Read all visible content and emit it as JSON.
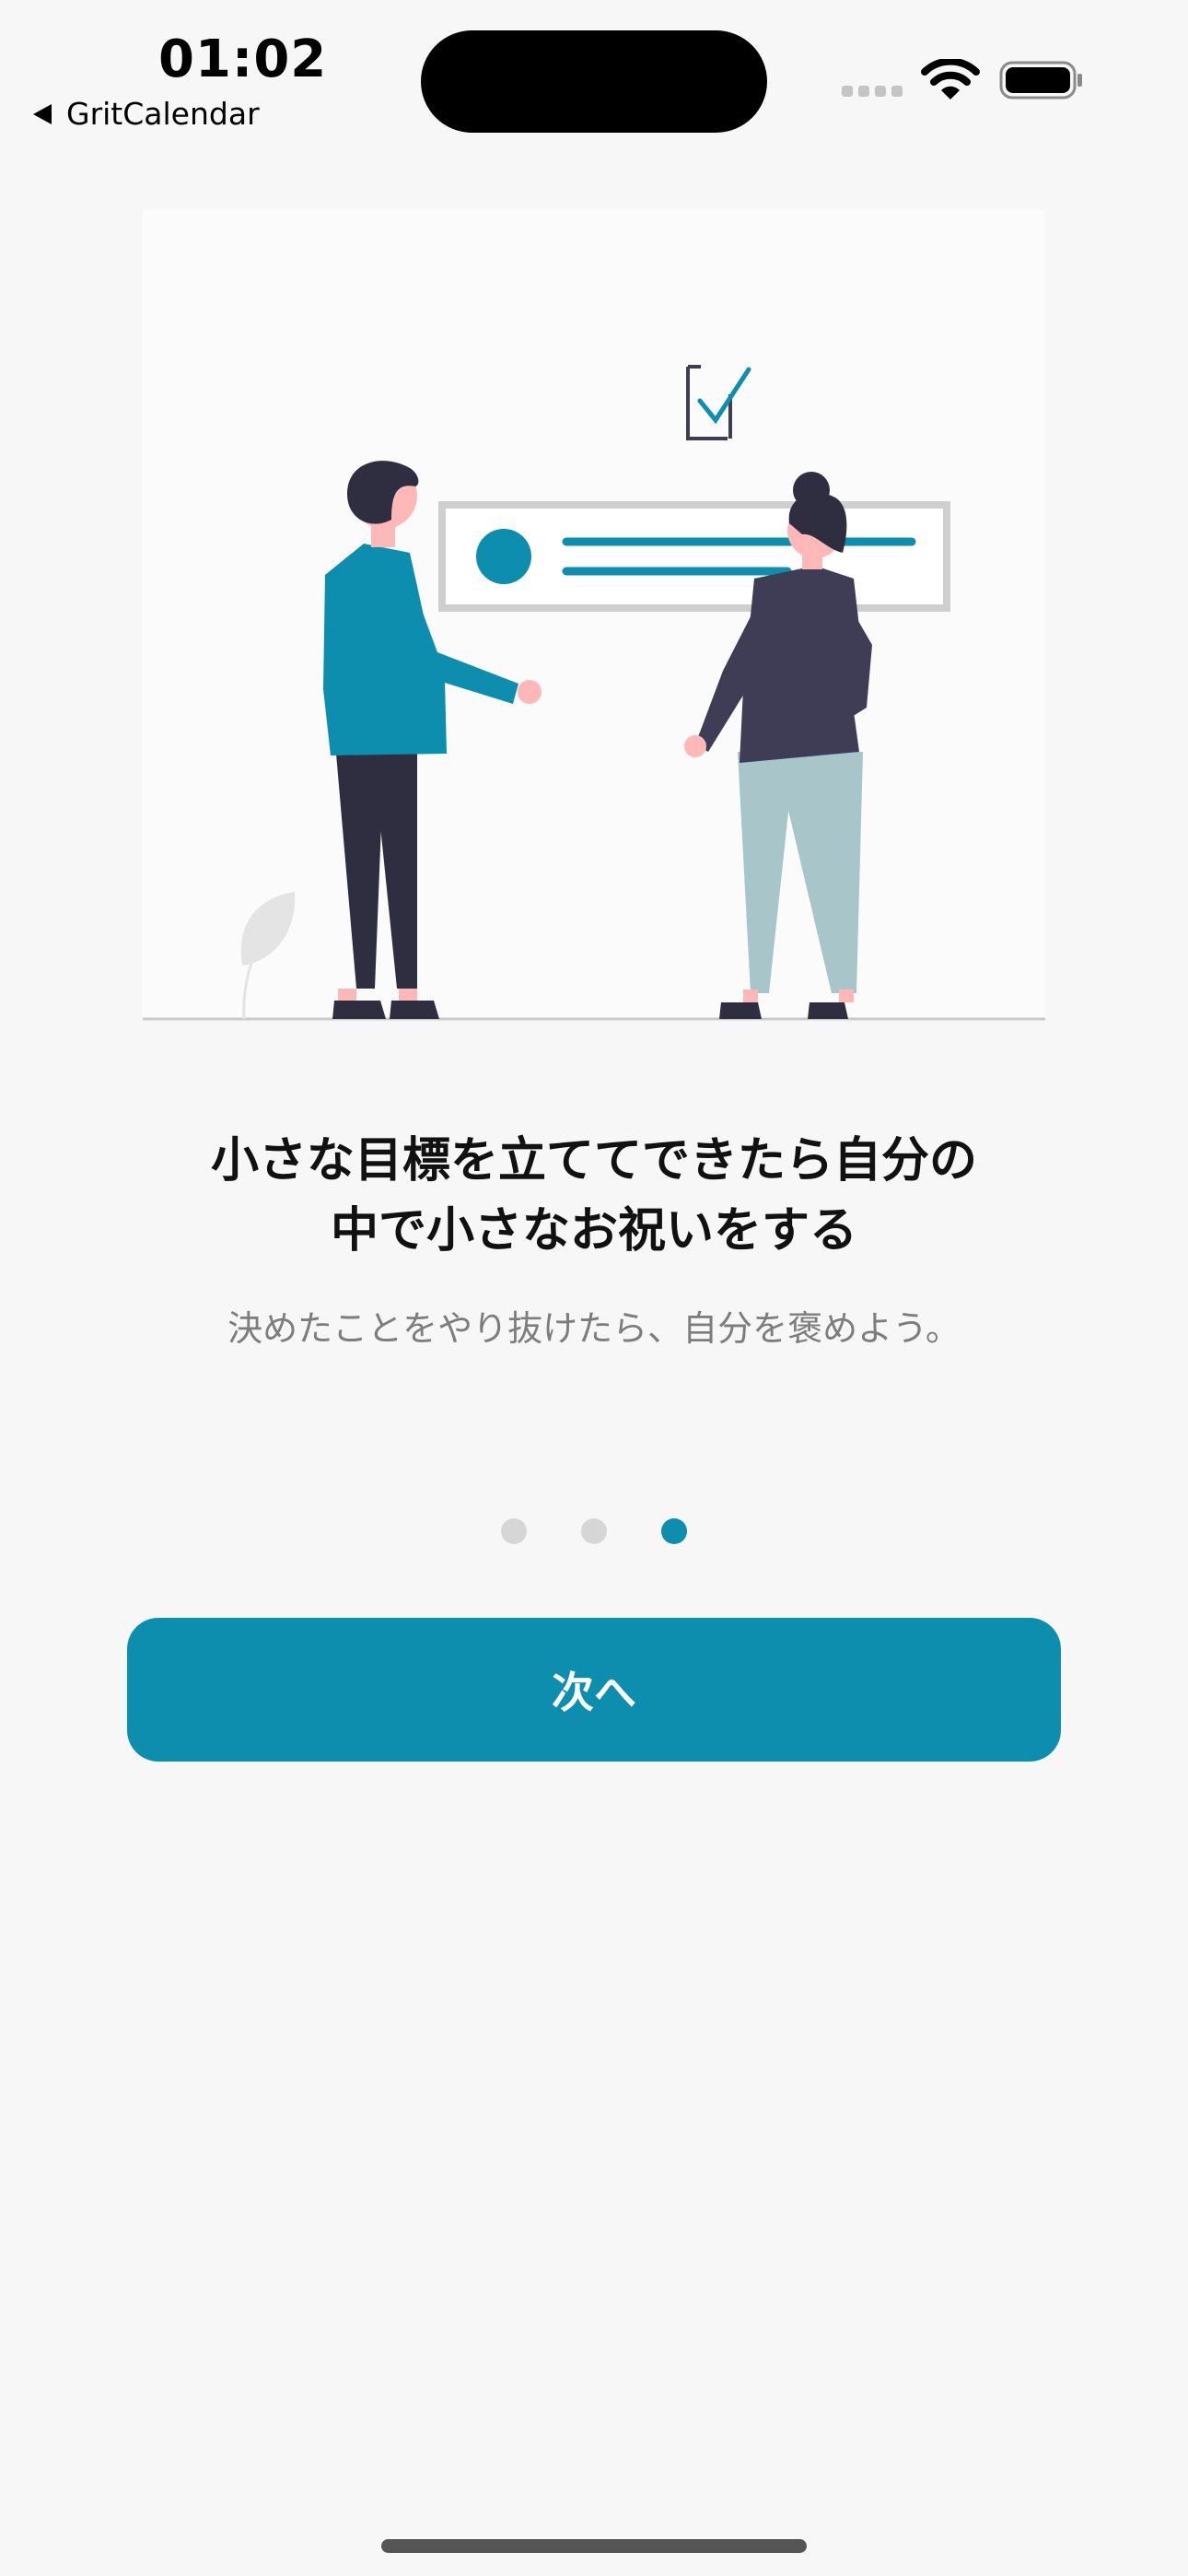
{
  "status_bar": {
    "time": "01:02",
    "back_app": "GritCalendar"
  },
  "onboarding": {
    "title_line1": "小さな目標を立ててできたら自分の",
    "title_line2": "中で小さなお祝いをする",
    "subtitle": "決めたことをやり抜けたら、自分を褒めよう。",
    "page_indicator": {
      "total": 3,
      "current": 3
    },
    "next_button_label": "次へ"
  },
  "colors": {
    "accent": "#0e8eae",
    "background": "#f7f7f7",
    "dot_inactive": "#d6d6d6"
  }
}
